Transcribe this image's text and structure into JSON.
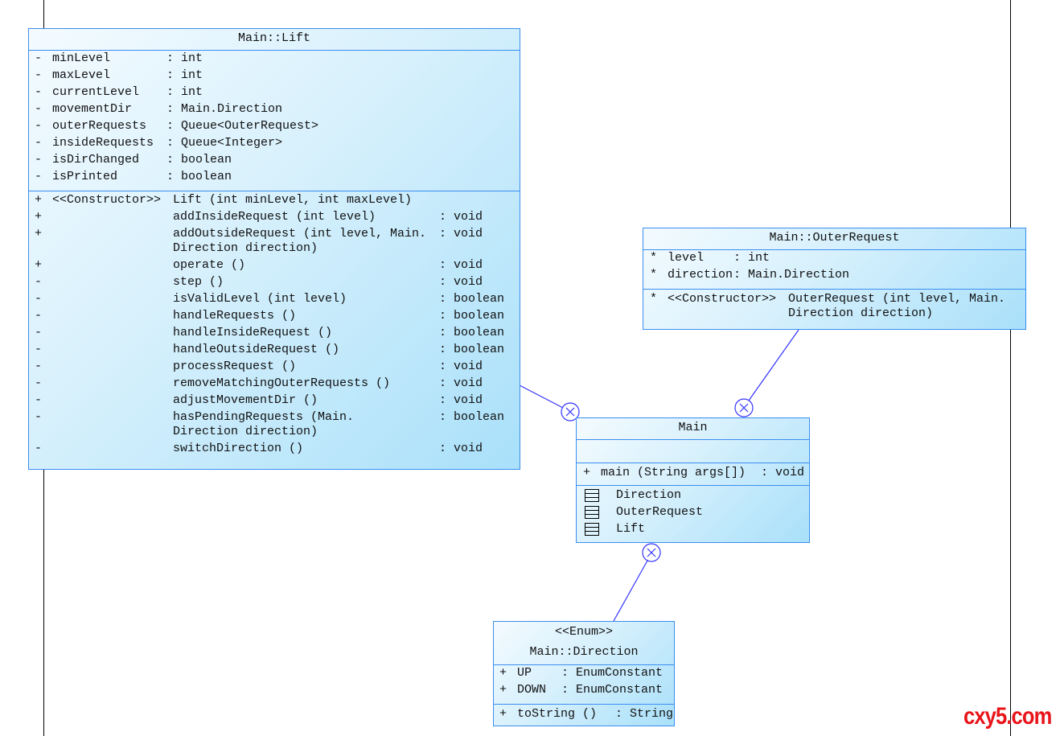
{
  "classes": {
    "lift": {
      "title": "Main::Lift",
      "attributes": [
        {
          "vis": "-",
          "name": "minLevel",
          "type": ": int"
        },
        {
          "vis": "-",
          "name": "maxLevel",
          "type": ": int"
        },
        {
          "vis": "-",
          "name": "currentLevel",
          "type": ": int"
        },
        {
          "vis": "-",
          "name": "movementDir",
          "type": ": Main.Direction"
        },
        {
          "vis": "-",
          "name": "outerRequests",
          "type": ": Queue<OuterRequest>"
        },
        {
          "vis": "-",
          "name": "insideRequests",
          "type": ": Queue<Integer>"
        },
        {
          "vis": "-",
          "name": "isDirChanged",
          "type": ": boolean"
        },
        {
          "vis": "-",
          "name": "isPrinted",
          "type": ": boolean"
        }
      ],
      "methods": [
        {
          "vis": "+",
          "stereo": "<<Constructor>>",
          "sig": "Lift (int minLevel, int maxLevel)",
          "ret": ""
        },
        {
          "vis": "+",
          "stereo": "",
          "sig": "addInsideRequest (int level)",
          "ret": ": void"
        },
        {
          "vis": "+",
          "stereo": "",
          "sig": "addOutsideRequest (int level, Main.\nDirection direction)",
          "ret": ": void"
        },
        {
          "vis": "+",
          "stereo": "",
          "sig": "operate ()",
          "ret": ": void"
        },
        {
          "vis": "-",
          "stereo": "",
          "sig": "step ()",
          "ret": ": void"
        },
        {
          "vis": "-",
          "stereo": "",
          "sig": "isValidLevel (int level)",
          "ret": ": boolean"
        },
        {
          "vis": "-",
          "stereo": "",
          "sig": "handleRequests ()",
          "ret": ": boolean"
        },
        {
          "vis": "-",
          "stereo": "",
          "sig": "handleInsideRequest ()",
          "ret": ": boolean"
        },
        {
          "vis": "-",
          "stereo": "",
          "sig": "handleOutsideRequest ()",
          "ret": ": boolean"
        },
        {
          "vis": "-",
          "stereo": "",
          "sig": "processRequest ()",
          "ret": ": void"
        },
        {
          "vis": "-",
          "stereo": "",
          "sig": "removeMatchingOuterRequests ()",
          "ret": ": void"
        },
        {
          "vis": "-",
          "stereo": "",
          "sig": "adjustMovementDir ()",
          "ret": ": void"
        },
        {
          "vis": "-",
          "stereo": "",
          "sig": "hasPendingRequests (Main.\nDirection direction)",
          "ret": ": boolean"
        },
        {
          "vis": "-",
          "stereo": "",
          "sig": "switchDirection ()",
          "ret": ": void"
        }
      ]
    },
    "outer": {
      "title": "Main::OuterRequest",
      "attributes": [
        {
          "vis": "*",
          "name": "level",
          "type": ": int"
        },
        {
          "vis": "*",
          "name": "direction",
          "type": ": Main.Direction"
        }
      ],
      "methods": [
        {
          "vis": "*",
          "stereo": "<<Constructor>>",
          "sig": "OuterRequest (int level, Main.\nDirection direction)",
          "ret": ""
        }
      ]
    },
    "main": {
      "title": "Main",
      "methods": [
        {
          "vis": "+",
          "sig": "main (String args[])",
          "ret": ": void"
        }
      ],
      "nested": [
        "Direction",
        "OuterRequest",
        "Lift"
      ]
    },
    "direction": {
      "stereotype": "<<Enum>>",
      "title": "Main::Direction",
      "attributes": [
        {
          "vis": "+",
          "name": "UP",
          "type": ": EnumConstant"
        },
        {
          "vis": "+",
          "name": "DOWN",
          "type": ": EnumConstant"
        }
      ],
      "methods": [
        {
          "vis": "+",
          "sig": "toString ()",
          "ret": ": String"
        }
      ]
    }
  },
  "colors": {
    "border": "#3a8ef0",
    "link": "#3333ff",
    "watermark": "#e8141a"
  },
  "watermark": "cxy5.com"
}
